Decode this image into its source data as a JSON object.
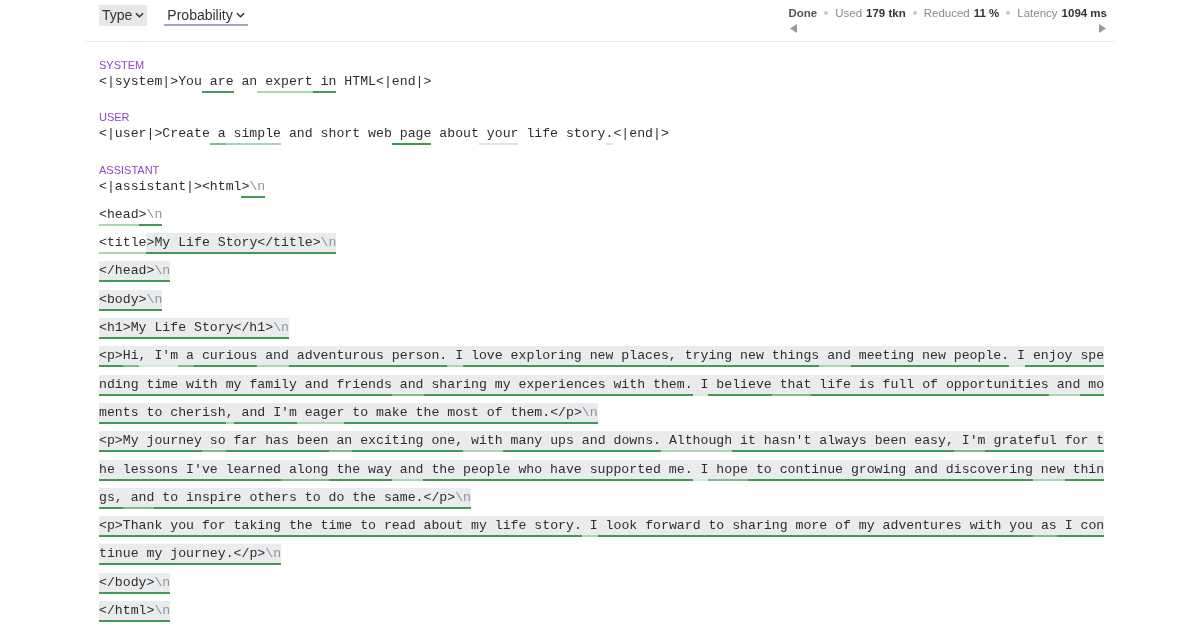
{
  "toolbar": {
    "view_options": [
      {
        "label": "Type",
        "selected": false
      },
      {
        "label": "Probability",
        "selected": true
      }
    ],
    "status": "Done",
    "stats": [
      {
        "label": "Used",
        "value": "179 tkn"
      },
      {
        "label": "Reduced",
        "value": "11 %"
      },
      {
        "label": "Latency",
        "value": "1094 ms"
      }
    ]
  },
  "messages": [
    {
      "role": "SYSTEM",
      "lines": [
        {
          "tokens": [
            {
              "text": "<|system|>",
              "shaded": false
            },
            {
              "text": "You",
              "shaded": false
            },
            {
              "text": " are",
              "color": "#3f9a53",
              "shaded": false
            },
            {
              "text": " an",
              "shaded": false
            },
            {
              "text": " expert",
              "color": "#a8d7b1",
              "shaded": false
            },
            {
              "text": " in",
              "color": "#3f9a53",
              "shaded": false
            },
            {
              "text": " HTML",
              "shaded": false
            },
            {
              "text": "<|end|>",
              "shaded": false
            }
          ]
        }
      ]
    },
    {
      "role": "USER",
      "lines": [
        {
          "tokens": [
            {
              "text": "<|user|>",
              "shaded": false
            },
            {
              "text": "Create",
              "shaded": false
            },
            {
              "text": " a",
              "color": "#79bd87",
              "shaded": false
            },
            {
              "text": " simple",
              "color": "#a8d7b1",
              "shaded": false
            },
            {
              "text": " and",
              "shaded": false
            },
            {
              "text": " short",
              "shaded": false
            },
            {
              "text": " web",
              "shaded": false
            },
            {
              "text": " page",
              "color": "#3f9a53",
              "shaded": false
            },
            {
              "text": " about",
              "shaded": false
            },
            {
              "text": " your",
              "color": "#d3ebd8",
              "shaded": false
            },
            {
              "text": " life",
              "shaded": false
            },
            {
              "text": " story",
              "shaded": false
            },
            {
              "text": ".",
              "color": "#d3ebd8",
              "shaded": false
            },
            {
              "text": "<|end|>",
              "shaded": false
            }
          ]
        }
      ]
    },
    {
      "role": "ASSISTANT",
      "lines": [
        {
          "tokens": [
            {
              "text": "<|assistant|>",
              "shaded": false
            },
            {
              "text": "<html",
              "shaded": false
            },
            {
              "text": ">",
              "newline_mark": "\\n",
              "color": "#3f9a53",
              "shaded": false
            }
          ]
        },
        {
          "tokens": [
            {
              "text": "<head",
              "color": "#a8d7b1",
              "shaded": false
            },
            {
              "text": ">",
              "newline_mark": "\\n",
              "color": "#3f9a53",
              "shaded": false
            }
          ]
        },
        {
          "tokens": [
            {
              "text": "<title",
              "color": "#a8d7b1",
              "shaded": false
            },
            {
              "text": ">My",
              "color": "#3f9a53",
              "shaded": true
            },
            {
              "text": " Life",
              "color": "#3f9a53",
              "shaded": true
            },
            {
              "text": " Story",
              "color": "#3f9a53",
              "shaded": true
            },
            {
              "text": "</title>",
              "newline_mark": "\\n",
              "color": "#3f9a53",
              "shaded": true
            }
          ]
        },
        {
          "tokens": [
            {
              "text": "</head>",
              "newline_mark": "\\n",
              "color": "#3f9a53",
              "shaded": true
            }
          ]
        },
        {
          "tokens": [
            {
              "text": "<body>",
              "newline_mark": "\\n",
              "color": "#3f9a53",
              "shaded": true
            }
          ]
        },
        {
          "tokens": [
            {
              "text": "<h1>My",
              "color": "#3f9a53",
              "shaded": true
            },
            {
              "text": " Life",
              "color": "#3f9a53",
              "shaded": true
            },
            {
              "text": " Story",
              "color": "#3f9a53",
              "shaded": true
            },
            {
              "text": "</h1>",
              "newline_mark": "\\n",
              "color": "#3f9a53",
              "shaded": true
            }
          ]
        },
        {
          "tokens": [
            {
              "text": "<p>",
              "color": "#3f9a53",
              "shaded": true
            },
            {
              "text": "Hi",
              "color": "#79bd87",
              "shaded": true
            },
            {
              "text": ",",
              "color": "#d3ebd8",
              "shaded": true
            },
            {
              "text": " I'm",
              "color": "#d3ebd8",
              "shaded": true
            },
            {
              "text": " a",
              "color": "#79bd87",
              "shaded": true
            },
            {
              "text": " curious",
              "color": "#3f9a53",
              "shaded": true
            },
            {
              "text": " and",
              "color": "#a8d7b1",
              "shaded": true
            },
            {
              "text": " adventurous",
              "color": "#3f9a53",
              "shaded": true
            },
            {
              "text": " person.",
              "color": "#3f9a53",
              "shaded": true
            },
            {
              "text": " I",
              "color": "#a8d7b1",
              "shaded": true
            },
            {
              "text": " love",
              "color": "#3f9a53",
              "shaded": true
            },
            {
              "text": " exploring",
              "color": "#3f9a53",
              "shaded": true
            },
            {
              "text": " new",
              "color": "#3f9a53",
              "shaded": true
            },
            {
              "text": " places,",
              "color": "#3f9a53",
              "shaded": true
            },
            {
              "text": " trying",
              "color": "#3f9a53",
              "shaded": true
            },
            {
              "text": " new",
              "color": "#3f9a53",
              "shaded": true
            },
            {
              "text": " things",
              "color": "#3f9a53",
              "shaded": true
            },
            {
              "text": " and",
              "color": "#a8d7b1",
              "shaded": true
            },
            {
              "text": " meeting",
              "color": "#3f9a53",
              "shaded": true
            },
            {
              "text": " new",
              "color": "#3f9a53",
              "shaded": true
            },
            {
              "text": " people.",
              "color": "#3f9a53",
              "shaded": true
            },
            {
              "text": " I",
              "color": "#d3ebd8",
              "shaded": true
            },
            {
              "text": " enjoy",
              "color": "#3f9a53",
              "shaded": true
            },
            {
              "text": " spe",
              "color": "#3f9a53",
              "shaded": true
            }
          ]
        },
        {
          "tokens": [
            {
              "text": "nding",
              "color": "#3f9a53",
              "shaded": true
            },
            {
              "text": " time",
              "color": "#3f9a53",
              "shaded": true
            },
            {
              "text": " with",
              "color": "#3f9a53",
              "shaded": true
            },
            {
              "text": " my",
              "color": "#3f9a53",
              "shaded": true
            },
            {
              "text": " family",
              "color": "#3f9a53",
              "shaded": true
            },
            {
              "text": " and",
              "color": "#3f9a53",
              "shaded": true
            },
            {
              "text": " friends",
              "color": "#3f9a53",
              "shaded": true
            },
            {
              "text": " and",
              "color": "#79bd87",
              "shaded": true
            },
            {
              "text": " sharing",
              "color": "#3f9a53",
              "shaded": true
            },
            {
              "text": " my",
              "color": "#3f9a53",
              "shaded": true
            },
            {
              "text": " experiences",
              "color": "#3f9a53",
              "shaded": true
            },
            {
              "text": " with",
              "color": "#3f9a53",
              "shaded": true
            },
            {
              "text": " them.",
              "color": "#3f9a53",
              "shaded": true
            },
            {
              "text": " I",
              "color": "#d3ebd8",
              "shaded": true
            },
            {
              "text": " believe",
              "color": "#3f9a53",
              "shaded": true
            },
            {
              "text": " that",
              "color": "#79bd87",
              "shaded": true
            },
            {
              "text": " life",
              "color": "#3f9a53",
              "shaded": true
            },
            {
              "text": " is",
              "color": "#3f9a53",
              "shaded": true
            },
            {
              "text": " full",
              "color": "#3f9a53",
              "shaded": true
            },
            {
              "text": " of",
              "color": "#3f9a53",
              "shaded": true
            },
            {
              "text": " opportunities",
              "color": "#3f9a53",
              "shaded": true
            },
            {
              "text": " and",
              "color": "#a8d7b1",
              "shaded": true
            },
            {
              "text": " mo",
              "color": "#3f9a53",
              "shaded": true
            }
          ]
        },
        {
          "tokens": [
            {
              "text": "ments",
              "color": "#3f9a53",
              "shaded": true
            },
            {
              "text": " to",
              "color": "#3f9a53",
              "shaded": true
            },
            {
              "text": " cherish",
              "color": "#3f9a53",
              "shaded": true
            },
            {
              "text": ",",
              "color": "#a8d7b1",
              "shaded": true
            },
            {
              "text": " and",
              "color": "#3f9a53",
              "shaded": true
            },
            {
              "text": " I'm",
              "color": "#3f9a53",
              "shaded": true
            },
            {
              "text": " eager",
              "color": "#a8d7b1",
              "shaded": true
            },
            {
              "text": " to",
              "color": "#3f9a53",
              "shaded": true
            },
            {
              "text": " make",
              "color": "#3f9a53",
              "shaded": true
            },
            {
              "text": " the",
              "color": "#3f9a53",
              "shaded": true
            },
            {
              "text": " most",
              "color": "#3f9a53",
              "shaded": true
            },
            {
              "text": " of",
              "color": "#3f9a53",
              "shaded": true
            },
            {
              "text": " them.",
              "color": "#3f9a53",
              "shaded": true
            },
            {
              "text": "</p>",
              "newline_mark": "\\n",
              "color": "#3f9a53",
              "shaded": true
            }
          ]
        },
        {
          "tokens": [
            {
              "text": "<p>",
              "color": "#3f9a53",
              "shaded": true
            },
            {
              "text": "My",
              "color": "#3f9a53",
              "shaded": true
            },
            {
              "text": " journey",
              "color": "#3f9a53",
              "shaded": true
            },
            {
              "text": " so",
              "color": "#79bd87",
              "shaded": true
            },
            {
              "text": " far",
              "color": "#3f9a53",
              "shaded": true
            },
            {
              "text": " has",
              "color": "#3f9a53",
              "shaded": true
            },
            {
              "text": " been",
              "color": "#3f9a53",
              "shaded": true
            },
            {
              "text": " an",
              "color": "#79bd87",
              "shaded": true
            },
            {
              "text": " exciting",
              "color": "#3f9a53",
              "shaded": true
            },
            {
              "text": " one,",
              "color": "#3f9a53",
              "shaded": true
            },
            {
              "text": " with",
              "color": "#a8d7b1",
              "shaded": true
            },
            {
              "text": " many",
              "color": "#3f9a53",
              "shaded": true
            },
            {
              "text": " ups",
              "color": "#3f9a53",
              "shaded": true
            },
            {
              "text": " and",
              "color": "#3f9a53",
              "shaded": true
            },
            {
              "text": " downs.",
              "color": "#3f9a53",
              "shaded": true
            },
            {
              "text": " Although",
              "color": "#a8d7b1",
              "shaded": true
            },
            {
              "text": " it",
              "color": "#3f9a53",
              "shaded": true
            },
            {
              "text": " hasn't",
              "color": "#3f9a53",
              "shaded": true
            },
            {
              "text": " always",
              "color": "#3f9a53",
              "shaded": true
            },
            {
              "text": " been",
              "color": "#3f9a53",
              "shaded": true
            },
            {
              "text": " easy,",
              "color": "#3f9a53",
              "shaded": true
            },
            {
              "text": " I'm",
              "color": "#79bd87",
              "shaded": true
            },
            {
              "text": " grateful",
              "color": "#3f9a53",
              "shaded": true
            },
            {
              "text": " for",
              "color": "#3f9a53",
              "shaded": true
            },
            {
              "text": " t",
              "color": "#3f9a53",
              "shaded": true
            }
          ]
        },
        {
          "tokens": [
            {
              "text": "he",
              "color": "#3f9a53",
              "shaded": true
            },
            {
              "text": " lessons",
              "color": "#3f9a53",
              "shaded": true
            },
            {
              "text": " I've",
              "color": "#3f9a53",
              "shaded": true
            },
            {
              "text": " learned",
              "color": "#3f9a53",
              "shaded": true
            },
            {
              "text": " along",
              "color": "#79bd87",
              "shaded": true
            },
            {
              "text": " the",
              "color": "#3f9a53",
              "shaded": true
            },
            {
              "text": " way",
              "color": "#3f9a53",
              "shaded": true
            },
            {
              "text": " and",
              "color": "#a8d7b1",
              "shaded": true
            },
            {
              "text": " the",
              "color": "#3f9a53",
              "shaded": true
            },
            {
              "text": " people",
              "color": "#3f9a53",
              "shaded": true
            },
            {
              "text": " who",
              "color": "#3f9a53",
              "shaded": true
            },
            {
              "text": " have",
              "color": "#3f9a53",
              "shaded": true
            },
            {
              "text": " supported",
              "color": "#3f9a53",
              "shaded": true
            },
            {
              "text": " me.",
              "color": "#3f9a53",
              "shaded": true
            },
            {
              "text": " I",
              "color": "#d3ebd8",
              "shaded": true
            },
            {
              "text": " hope",
              "color": "#79bd87",
              "shaded": true
            },
            {
              "text": " to",
              "color": "#3f9a53",
              "shaded": true
            },
            {
              "text": " continue",
              "color": "#3f9a53",
              "shaded": true
            },
            {
              "text": " growing",
              "color": "#3f9a53",
              "shaded": true
            },
            {
              "text": " and",
              "color": "#3f9a53",
              "shaded": true
            },
            {
              "text": " discovering",
              "color": "#3f9a53",
              "shaded": true
            },
            {
              "text": " new",
              "color": "#a8d7b1",
              "shaded": true
            },
            {
              "text": " thin",
              "color": "#3f9a53",
              "shaded": true
            }
          ]
        },
        {
          "tokens": [
            {
              "text": "gs,",
              "color": "#3f9a53",
              "shaded": true
            },
            {
              "text": " and",
              "color": "#79bd87",
              "shaded": true
            },
            {
              "text": " to",
              "color": "#3f9a53",
              "shaded": true
            },
            {
              "text": " inspire",
              "color": "#3f9a53",
              "shaded": true
            },
            {
              "text": " others",
              "color": "#3f9a53",
              "shaded": true
            },
            {
              "text": " to",
              "color": "#3f9a53",
              "shaded": true
            },
            {
              "text": " do",
              "color": "#3f9a53",
              "shaded": true
            },
            {
              "text": " the",
              "color": "#3f9a53",
              "shaded": true
            },
            {
              "text": " same.",
              "color": "#3f9a53",
              "shaded": true
            },
            {
              "text": "</p>",
              "newline_mark": "\\n",
              "color": "#3f9a53",
              "shaded": true
            }
          ]
        },
        {
          "tokens": [
            {
              "text": "<p>",
              "color": "#3f9a53",
              "shaded": true
            },
            {
              "text": "Thank",
              "color": "#3f9a53",
              "shaded": true
            },
            {
              "text": " you",
              "color": "#3f9a53",
              "shaded": true
            },
            {
              "text": " for",
              "color": "#3f9a53",
              "shaded": true
            },
            {
              "text": " taking",
              "color": "#3f9a53",
              "shaded": true
            },
            {
              "text": " the",
              "color": "#3f9a53",
              "shaded": true
            },
            {
              "text": " time",
              "color": "#3f9a53",
              "shaded": true
            },
            {
              "text": " to",
              "color": "#3f9a53",
              "shaded": true
            },
            {
              "text": " read",
              "color": "#3f9a53",
              "shaded": true
            },
            {
              "text": " about",
              "color": "#3f9a53",
              "shaded": true
            },
            {
              "text": " my",
              "color": "#3f9a53",
              "shaded": true
            },
            {
              "text": " life",
              "color": "#3f9a53",
              "shaded": true
            },
            {
              "text": " story.",
              "color": "#3f9a53",
              "shaded": true
            },
            {
              "text": " I",
              "color": "#a8d7b1",
              "shaded": true
            },
            {
              "text": " look",
              "color": "#3f9a53",
              "shaded": true
            },
            {
              "text": " forward",
              "color": "#3f9a53",
              "shaded": true
            },
            {
              "text": " to",
              "color": "#3f9a53",
              "shaded": true
            },
            {
              "text": " sharing",
              "color": "#3f9a53",
              "shaded": true
            },
            {
              "text": " more",
              "color": "#3f9a53",
              "shaded": true
            },
            {
              "text": " of",
              "color": "#3f9a53",
              "shaded": true
            },
            {
              "text": " my",
              "color": "#3f9a53",
              "shaded": true
            },
            {
              "text": " adventures",
              "color": "#3f9a53",
              "shaded": true
            },
            {
              "text": " with",
              "color": "#3f9a53",
              "shaded": true
            },
            {
              "text": " you",
              "color": "#3f9a53",
              "shaded": true
            },
            {
              "text": " as",
              "color": "#79bd87",
              "shaded": true
            },
            {
              "text": " I",
              "color": "#3f9a53",
              "shaded": true
            },
            {
              "text": " con",
              "color": "#3f9a53",
              "shaded": true
            }
          ]
        },
        {
          "tokens": [
            {
              "text": "tinue",
              "color": "#3f9a53",
              "shaded": true
            },
            {
              "text": " my",
              "color": "#3f9a53",
              "shaded": true
            },
            {
              "text": " journey.",
              "color": "#3f9a53",
              "shaded": true
            },
            {
              "text": "</p>",
              "newline_mark": "\\n",
              "color": "#3f9a53",
              "shaded": true
            }
          ]
        },
        {
          "tokens": [
            {
              "text": "</body>",
              "newline_mark": "\\n",
              "color": "#3f9a53",
              "shaded": true
            }
          ]
        },
        {
          "tokens": [
            {
              "text": "</html>",
              "newline_mark": "\\n",
              "color": "#3f9a53",
              "shaded": true
            }
          ]
        }
      ]
    }
  ]
}
